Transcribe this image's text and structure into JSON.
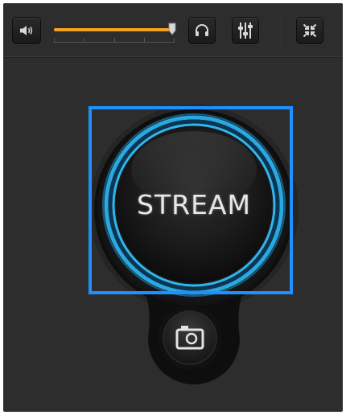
{
  "toolbar": {
    "volume": 0.98,
    "volume_icon": "speaker-icon",
    "headphones_icon": "headphones-icon",
    "mixer_icon": "mixer-sliders-icon",
    "fullscreen_icon": "fullscreen-collapse-icon"
  },
  "main": {
    "stream_label": "STREAM",
    "snapshot_icon": "camera-icon"
  },
  "colors": {
    "panel_bg": "#2d2d2d",
    "volume_fill": "#f4a322",
    "ring_glow": "#2aa8e0",
    "selection_outline": "#1e90ff"
  }
}
